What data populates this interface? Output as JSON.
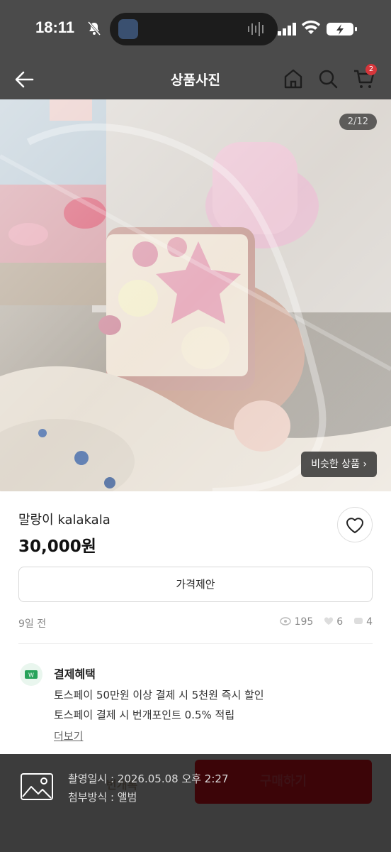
{
  "status_bar": {
    "time": "18:11"
  },
  "nav": {
    "title": "상품사진",
    "cart_badge": "2"
  },
  "photo": {
    "counter": "2/12",
    "similar_button": "비슷한 상품 ›"
  },
  "product": {
    "title": "말랑이 kalakala",
    "price": "30,000원",
    "offer_button": "가격제안",
    "posted": "9일 전",
    "views": "195",
    "likes": "6",
    "chats": "4"
  },
  "payment": {
    "title": "결제혜택",
    "line1": "토스페이 50만원 이상 결제 시 5천원 즉시 할인",
    "line2": "토스페이 결제 시 번개포인트 0.5% 적립",
    "more": "더보기"
  },
  "bottom": {
    "chat_button": "번개톡",
    "buy_button": "구매하기",
    "meta_line1": "촬영일시 : 2026.05.08 오후 2:27",
    "meta_line2": "첨부방식 : 앨범"
  },
  "colors": {
    "accent": "#d6363b",
    "buy_dim": "#3c0508",
    "overlay": "#4b4b4b"
  }
}
